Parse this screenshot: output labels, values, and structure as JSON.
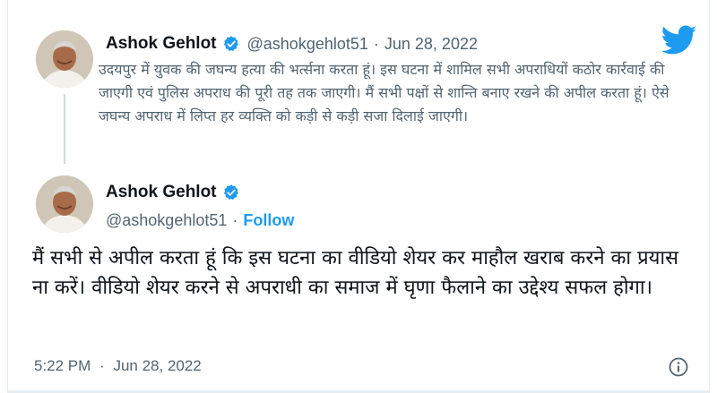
{
  "quoted_tweet": {
    "author_name": "Ashok Gehlot",
    "author_handle": "@ashokgehlot51",
    "separator": "·",
    "date": "Jun 28, 2022",
    "text": "उदयपुर में युवक की जघन्य हत्या की भर्त्सना करता हूं। इस घटना में शामिल सभी अपराधियों कठोर कार्रवाई की जाएगी एवं पुलिस अपराध की पूरी तह तक जाएगी। मैं सभी पक्षों से शान्ति बनाए रखने की अपील करता हूं। ऐसे जघन्य अपराध में लिप्त हर व्यक्ति को कड़ी से कड़ी सजा दिलाई जाएगी।"
  },
  "main_tweet": {
    "author_name": "Ashok Gehlot",
    "author_handle": "@ashokgehlot51",
    "separator": "·",
    "follow_label": "Follow",
    "text": "मैं सभी से अपील करता हूं कि इस घटना का वीडियो शेयर कर माहौल खराब करने का प्रयास ना करें। वीडियो शेयर करने से अपराधी का समाज में घृणा फैलाने का उद्देश्य सफल होगा।",
    "time": "5:22 PM",
    "date": "Jun 28, 2022"
  },
  "icons": {
    "brand": "twitter-bird-icon",
    "verified": "verified-badge-icon",
    "info": "info-icon"
  },
  "colors": {
    "brand_blue": "#1d9bf0",
    "text": "#0f1419",
    "muted": "#536471"
  }
}
